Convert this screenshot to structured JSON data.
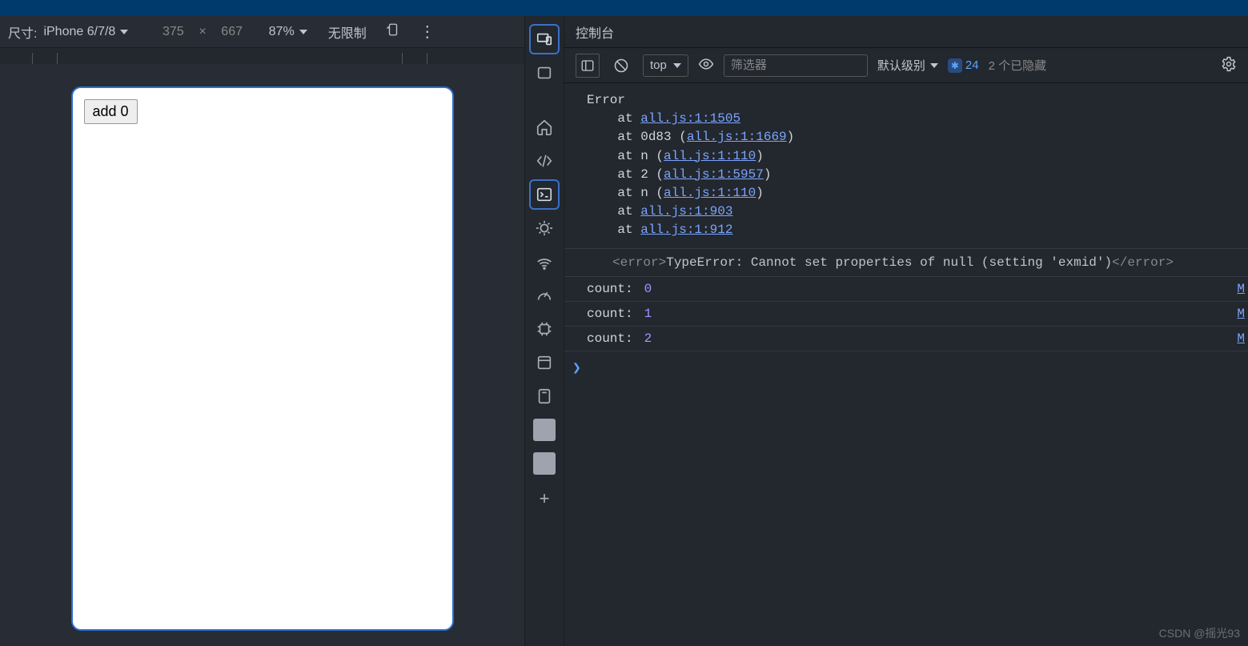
{
  "deviceToolbar": {
    "dimLabel": "尺寸:",
    "deviceName": "iPhone 6/7/8",
    "width": "375",
    "xSymbol": "×",
    "height": "667",
    "zoom": "87%",
    "throttle": "无限制"
  },
  "page": {
    "addButton": "add 0"
  },
  "console": {
    "header": "控制台",
    "context": "top",
    "filterPlaceholder": "筛选器",
    "levelLabel": "默认级别",
    "issuesCount": "24",
    "hiddenCount": "2 个已隐藏"
  },
  "error": {
    "title": "Error",
    "stack": [
      {
        "prefix": "    at ",
        "mid": "",
        "link": "all.js:1:1505",
        "suffix": ""
      },
      {
        "prefix": "    at ",
        "mid": "0d83 (",
        "link": "all.js:1:1669",
        "suffix": ")"
      },
      {
        "prefix": "    at ",
        "mid": "n (",
        "link": "all.js:1:110",
        "suffix": ")"
      },
      {
        "prefix": "    at ",
        "mid": "2 (",
        "link": "all.js:1:5957",
        "suffix": ")"
      },
      {
        "prefix": "    at ",
        "mid": "n (",
        "link": "all.js:1:110",
        "suffix": ")"
      },
      {
        "prefix": "    at ",
        "mid": "",
        "link": "all.js:1:903",
        "suffix": ""
      },
      {
        "prefix": "    at ",
        "mid": "",
        "link": "all.js:1:912",
        "suffix": ""
      }
    ],
    "errTagOpen": "<error>",
    "errMessage": "TypeError: Cannot set properties of null (setting 'exmid')",
    "errTagClose": "</error>"
  },
  "logs": [
    {
      "label": "count:",
      "value": "0",
      "file": "M"
    },
    {
      "label": "count:",
      "value": "1",
      "file": "M"
    },
    {
      "label": "count:",
      "value": "2",
      "file": "M"
    }
  ],
  "watermark": "CSDN @摇光93"
}
